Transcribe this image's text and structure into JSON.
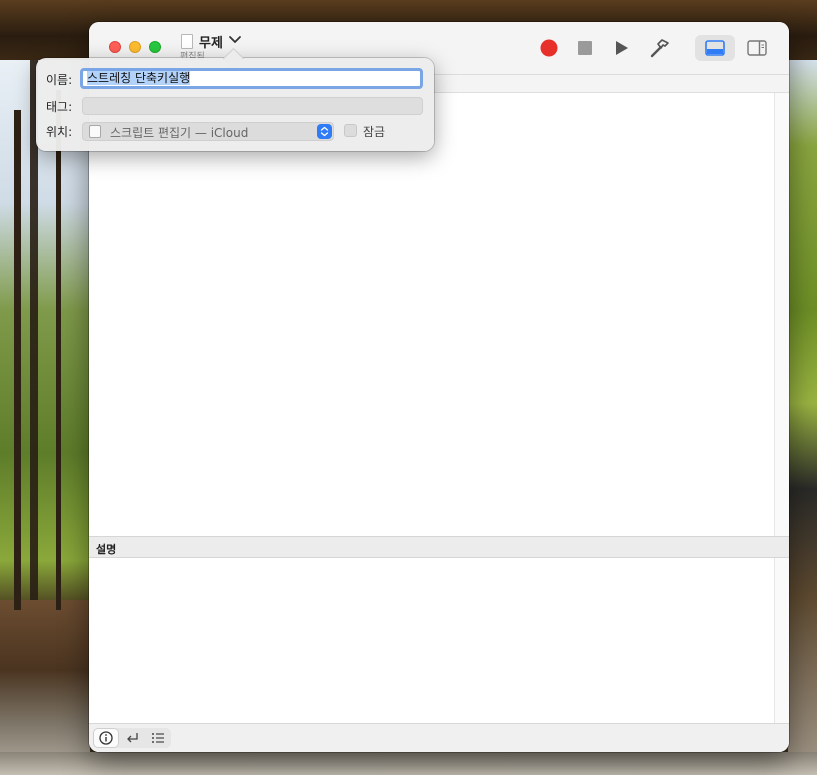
{
  "window": {
    "title": "무제",
    "subtitle": "편집됨"
  },
  "toolbar": {
    "record": "record-icon",
    "stop": "stop-icon",
    "run": "play-icon",
    "compile": "hammer-icon",
    "view_bottom": "bottom-panel-icon",
    "view_side": "side-panel-icon",
    "record_color": "#e8302a"
  },
  "save_popover": {
    "name_label": "이름:",
    "name_value": "스트레칭 단축키실행",
    "tags_label": "태그:",
    "tags_value": "",
    "location_label": "위치:",
    "location_value": "스크립트 편집기 — iCloud",
    "lock_label": "잠금",
    "lock_checked": false
  },
  "description_pane": {
    "label": "설명"
  },
  "bottom_bar": {
    "info": "info-icon",
    "return": "return-arrow-icon",
    "list": "list-icon"
  },
  "colors": {
    "accent": "#2f7cf6",
    "focus_ring": "#7aa6e6",
    "selection": "#b3d2f9"
  }
}
